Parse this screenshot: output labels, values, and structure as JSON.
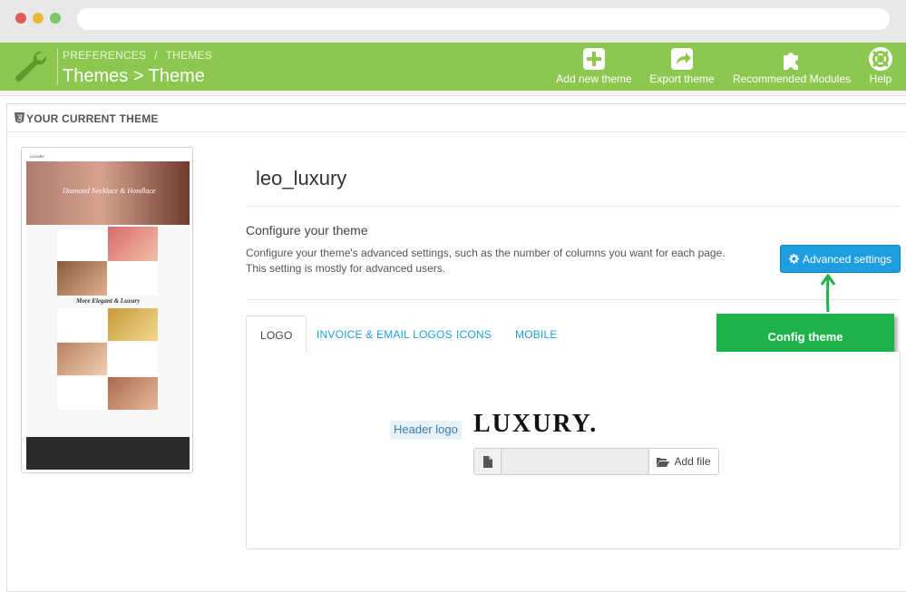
{
  "header": {
    "breadcrumb": [
      "PREFERENCES",
      "/",
      "THEMES"
    ],
    "title": "Themes > Theme",
    "toolbar": [
      {
        "label": "Add new theme",
        "icon": "plus-icon"
      },
      {
        "label": "Export theme",
        "icon": "export-icon"
      },
      {
        "label": "Recommended Modules",
        "icon": "puzzle-icon"
      },
      {
        "label": "Help",
        "icon": "lifebuoy-icon"
      }
    ]
  },
  "panel": {
    "heading": "YOUR CURRENT THEME"
  },
  "preview": {
    "hero_text": "Diamond Necklace & Handlace",
    "mid_title": "More Elegant & Luxury",
    "logo_small": "LUXURY"
  },
  "theme": {
    "name": "leo_luxury",
    "config_title": "Configure your theme",
    "config_desc_1": "Configure your theme's advanced settings, such as the number of columns you want for each page.",
    "config_desc_2": "This setting is mostly for advanced users.",
    "advanced_button": "Advanced settings",
    "callout": "Config theme"
  },
  "tabs": [
    {
      "label": "LOGO",
      "active": true
    },
    {
      "label": "INVOICE & EMAIL LOGOS",
      "active": false
    },
    {
      "label": "ICONS",
      "active": false
    },
    {
      "label": "MOBILE",
      "active": false
    }
  ],
  "logo_tab": {
    "label": "Header logo",
    "logo_text": "LUXURY.",
    "add_file": "Add file"
  },
  "colors": {
    "header_green": "#8cc850",
    "accent_blue": "#1e9ee0",
    "callout_green": "#1db34a"
  }
}
